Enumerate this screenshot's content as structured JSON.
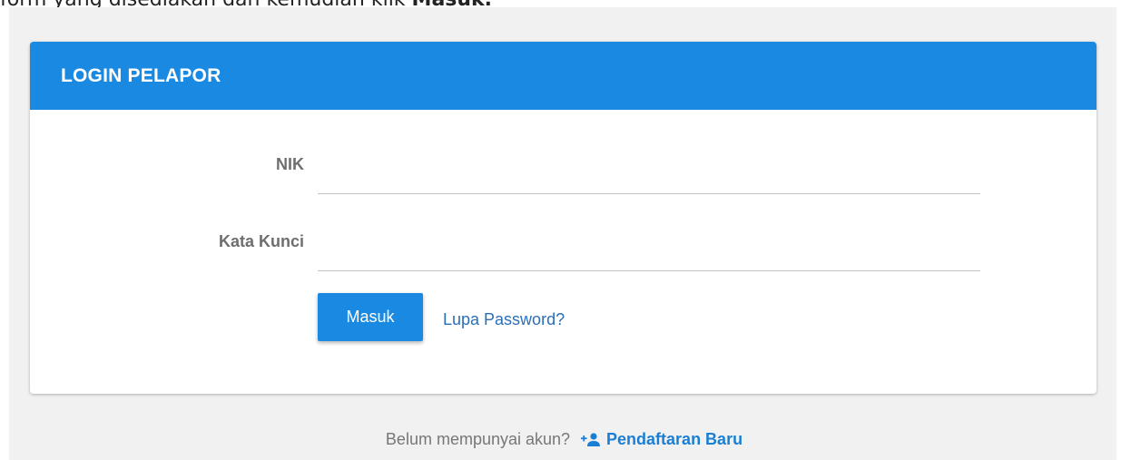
{
  "intro": {
    "text": "form yang disediakan dan kemudian klik ",
    "emphasis": "Masuk."
  },
  "card": {
    "title": "LOGIN PELAPOR"
  },
  "form": {
    "nik_label": "NIK",
    "nik_value": "",
    "password_label": "Kata Kunci",
    "password_value": "",
    "submit_label": "Masuk",
    "forgot_label": "Lupa Password?"
  },
  "footer": {
    "question": "Belum mempunyai akun?",
    "register_label": "Pendaftaran Baru",
    "register_icon": "add-user-icon"
  },
  "colors": {
    "primary": "#1a89e1",
    "link": "#2a6fb8",
    "background": "#f1f1f1"
  }
}
